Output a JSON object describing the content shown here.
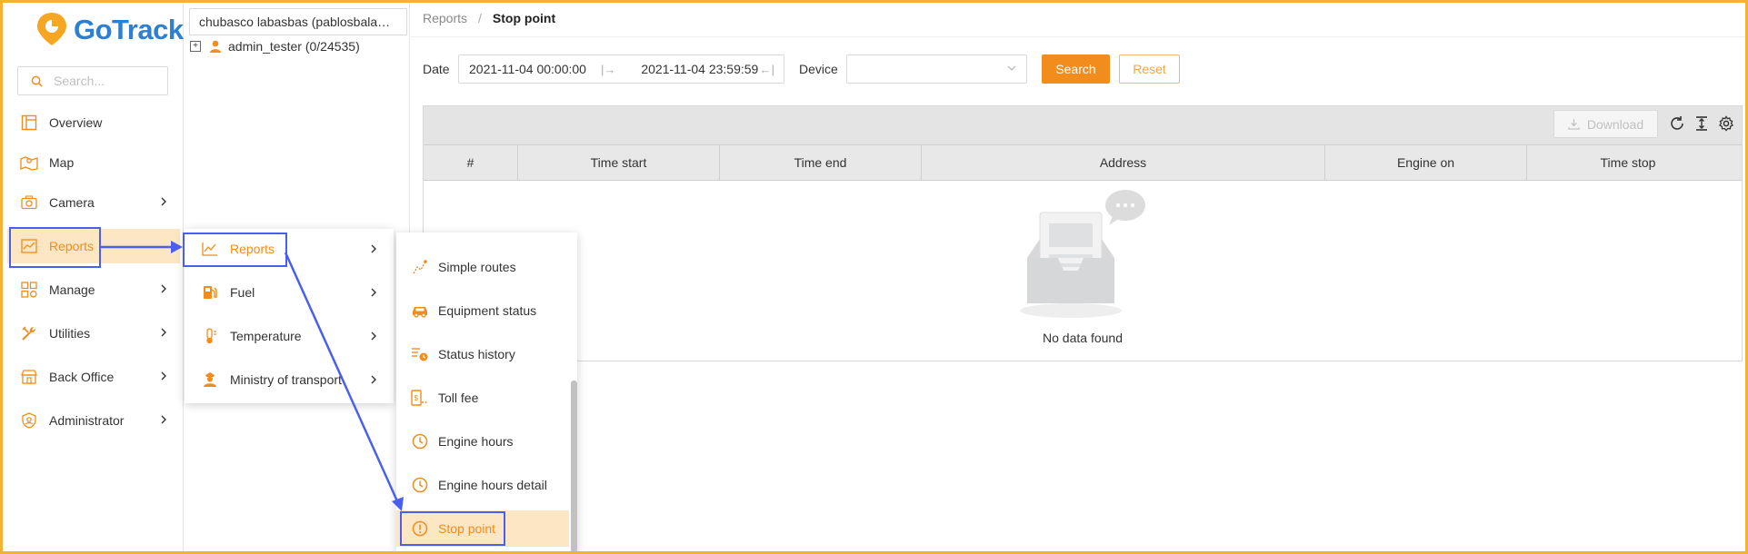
{
  "brand": {
    "name": "GoTrack",
    "accent": "#f28c1c",
    "logo_blue": "#2f7fd0"
  },
  "sidebar": {
    "search_placeholder": "Search...",
    "items": [
      {
        "label": "Overview",
        "icon": "overview-icon",
        "has_submenu": false
      },
      {
        "label": "Map",
        "icon": "map-icon",
        "has_submenu": false
      },
      {
        "label": "Camera",
        "icon": "camera-icon",
        "has_submenu": true
      },
      {
        "label": "Reports",
        "icon": "reports-icon",
        "has_submenu": false,
        "active": true
      },
      {
        "label": "Manage",
        "icon": "manage-icon",
        "has_submenu": true
      },
      {
        "label": "Utilities",
        "icon": "utilities-icon",
        "has_submenu": true
      },
      {
        "label": "Back Office",
        "icon": "back-office-icon",
        "has_submenu": true
      },
      {
        "label": "Administrator",
        "icon": "administrator-icon",
        "has_submenu": true
      }
    ]
  },
  "tree": {
    "selected": "chubasco labasbas (pablosbala…",
    "node_label": "admin_tester (0/24535)"
  },
  "breadcrumb": {
    "parent": "Reports",
    "separator": "/",
    "current": "Stop point"
  },
  "filters": {
    "date_label": "Date",
    "date_from": "2021-11-04 00:00:00",
    "date_to": "2021-11-04 23:59:59",
    "device_label": "Device",
    "device_value": "",
    "search_label": "Search",
    "reset_label": "Reset"
  },
  "table": {
    "download_label": "Download",
    "columns": [
      "#",
      "Time start",
      "Time end",
      "Address",
      "Engine on",
      "Time stop"
    ],
    "rows": [],
    "empty_text": "No data found"
  },
  "menu_level1": {
    "items": [
      {
        "label": "Reports",
        "icon": "line-chart-icon",
        "active": true
      },
      {
        "label": "Fuel",
        "icon": "fuel-icon"
      },
      {
        "label": "Temperature",
        "icon": "thermometer-icon"
      },
      {
        "label": "Ministry of transport",
        "icon": "officer-icon"
      }
    ]
  },
  "menu_level2": {
    "items": [
      {
        "label": "Simple routes",
        "icon": "route-icon"
      },
      {
        "label": "Equipment status",
        "icon": "car-icon"
      },
      {
        "label": "Status history",
        "icon": "history-icon"
      },
      {
        "label": "Toll fee",
        "icon": "toll-icon"
      },
      {
        "label": "Engine hours",
        "icon": "clock-icon"
      },
      {
        "label": "Engine hours detail",
        "icon": "clock-icon"
      },
      {
        "label": "Stop point",
        "icon": "alert-circle-icon",
        "active": true
      }
    ]
  },
  "annotation_color": "#4a5ff0"
}
